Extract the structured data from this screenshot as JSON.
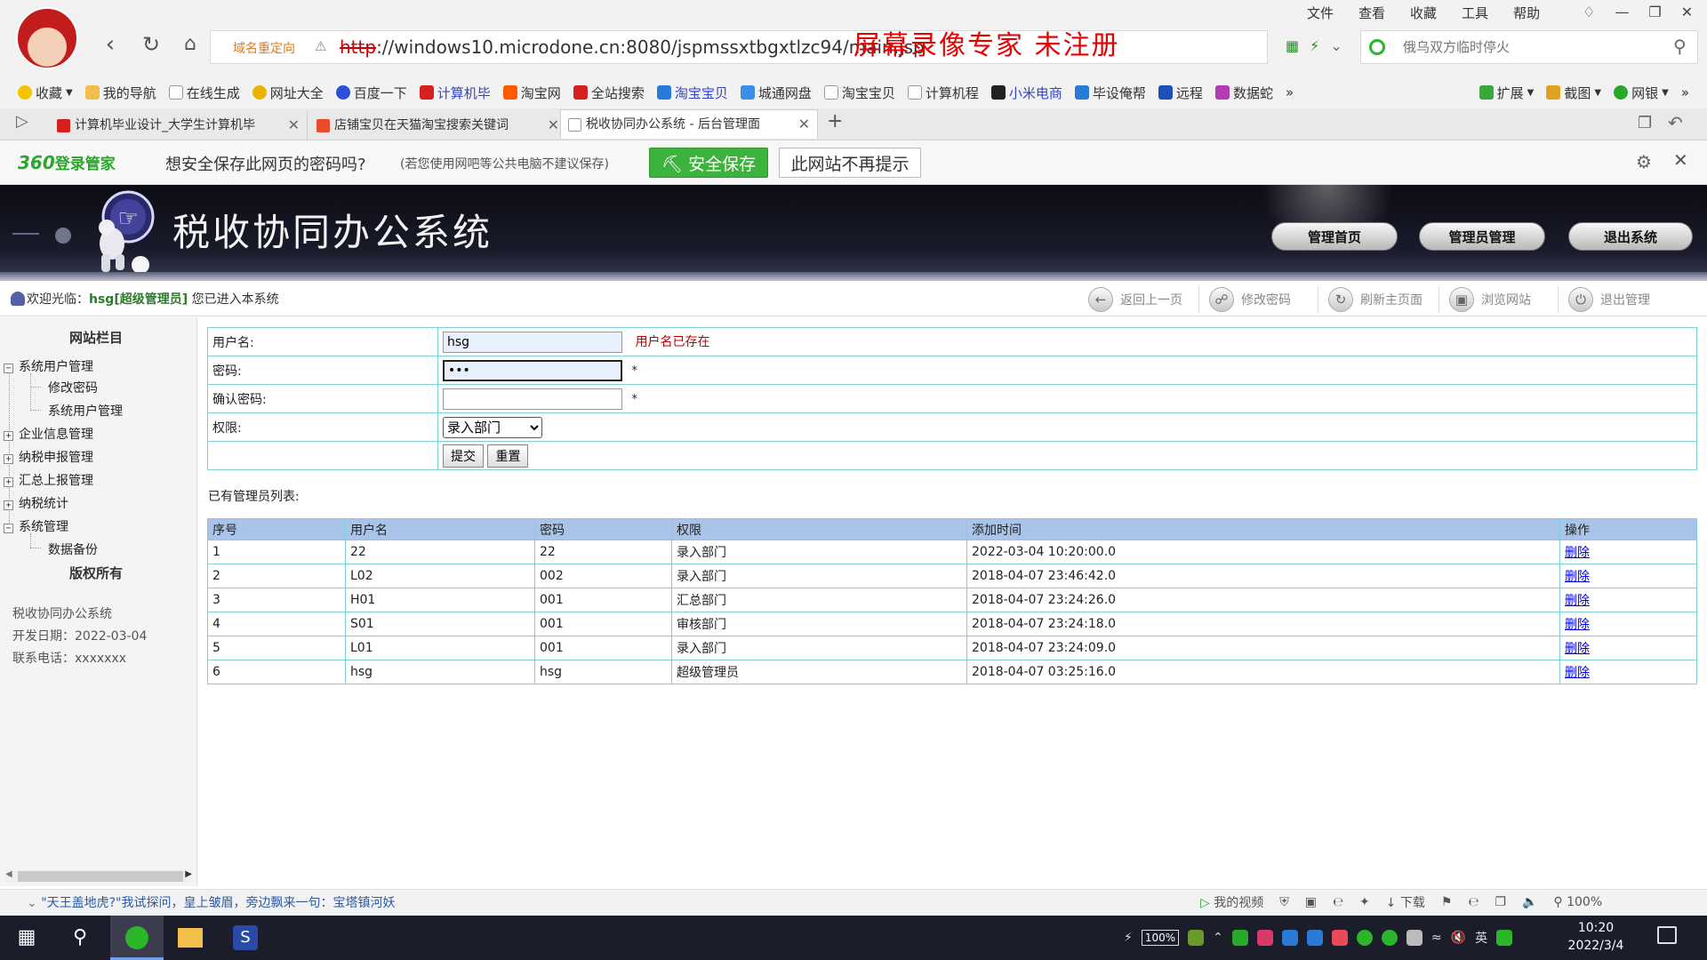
{
  "browser": {
    "menu": [
      "文件",
      "查看",
      "收藏",
      "工具",
      "帮助"
    ],
    "address": {
      "redirect_label": "域名重定向",
      "url_proto": "http",
      "url_rest": "://windows10.microdone.cn:8080/jspmssxtbgxtlzc94/main.jsp"
    },
    "watermark": "屏幕录像专家  未注册",
    "search_placeholder": "俄乌双方临时停火",
    "bookmarks": [
      "收藏",
      "我的导航",
      "在线生成",
      "网址大全",
      "百度一下",
      "计算机毕",
      "淘宝网",
      "全站搜索",
      "淘宝宝贝",
      "城通网盘",
      "淘宝宝贝",
      "计算机程",
      "小米电商",
      "毕设俺帮",
      "远程",
      "数据蛇"
    ],
    "bookmarks_right": [
      "扩展",
      "截图",
      "网银"
    ],
    "tabs": [
      {
        "title": "计算机毕业设计_大学生计算机毕"
      },
      {
        "title": "店铺宝贝在天猫淘宝搜索关键词"
      },
      {
        "title": "税收协同办公系统 - 后台管理面"
      }
    ],
    "password_bar": {
      "brand": "360",
      "brand_suffix": "登录管家",
      "question": "想安全保存此网页的密码吗?",
      "note": "(若您使用网吧等公共电脑不建议保存)",
      "save_label": "安全保存",
      "never_label": "此网站不再提示"
    }
  },
  "app": {
    "title": "税收协同办公系统",
    "nav": [
      "管理首页",
      "管理员管理",
      "退出系统"
    ],
    "welcome_prefix": "欢迎光临：",
    "welcome_user": "hsg[超级管理员]",
    "welcome_suffix": " 您已进入本系统",
    "tools": [
      "返回上一页",
      "修改密码",
      "刷新主页面",
      "浏览网站",
      "退出管理"
    ],
    "sidebar": {
      "title": "网站栏目",
      "tree": [
        {
          "label": "系统用户管理",
          "expanded": true,
          "children": [
            "修改密码",
            "系统用户管理"
          ]
        },
        {
          "label": "企业信息管理",
          "expanded": false
        },
        {
          "label": "纳税申报管理",
          "expanded": false
        },
        {
          "label": "汇总上报管理",
          "expanded": false
        },
        {
          "label": "纳税统计",
          "expanded": false
        },
        {
          "label": "系统管理",
          "expanded": true,
          "children": [
            "数据备份"
          ]
        }
      ],
      "copyright_title": "版权所有",
      "info": [
        "税收协同办公系统",
        "开发日期：2022-03-04",
        "联系电话：xxxxxxx"
      ]
    },
    "form": {
      "username_label": "用户名:",
      "username_value": "hsg",
      "username_error": "用户名已存在",
      "password_label": "密码:",
      "password_value": "•••",
      "confirm_label": "确认密码:",
      "confirm_value": "",
      "required_mark": "*",
      "role_label": "权限:",
      "role_selected": "录入部门",
      "submit_label": "提交",
      "reset_label": "重置"
    },
    "list_title": "已有管理员列表:",
    "table": {
      "headers": [
        "序号",
        "用户名",
        "密码",
        "权限",
        "添加时间",
        "操作"
      ],
      "rows": [
        [
          "1",
          "22",
          "22",
          "录入部门",
          "2022-03-04 10:20:00.0",
          "删除"
        ],
        [
          "2",
          "L02",
          "002",
          "录入部门",
          "2018-04-07 23:46:42.0",
          "删除"
        ],
        [
          "3",
          "H01",
          "001",
          "汇总部门",
          "2018-04-07 23:24:26.0",
          "删除"
        ],
        [
          "4",
          "S01",
          "001",
          "审核部门",
          "2018-04-07 23:24:18.0",
          "删除"
        ],
        [
          "5",
          "L01",
          "001",
          "录入部门",
          "2018-04-07 23:24:09.0",
          "删除"
        ],
        [
          "6",
          "hsg",
          "hsg",
          "超级管理员",
          "2018-04-07 03:25:16.0",
          "删除"
        ]
      ]
    }
  },
  "statusbar": {
    "news": "\"天王盖地虎?\"我试探问，皇上皱眉，旁边飘来一句：宝塔镇河妖",
    "items": [
      "我的视频",
      "下载",
      "100%"
    ]
  },
  "taskbar": {
    "battery": "100%",
    "ime": "英",
    "time": "10:20",
    "date": "2022/3/4"
  }
}
